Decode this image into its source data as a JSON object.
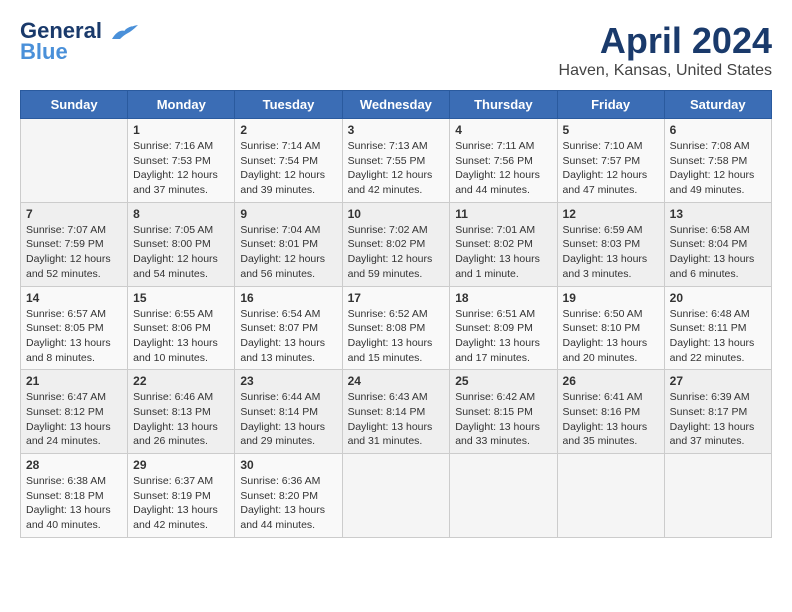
{
  "app": {
    "logo_line1": "General",
    "logo_line2": "Blue",
    "title": "April 2024",
    "subtitle": "Haven, Kansas, United States"
  },
  "calendar": {
    "headers": [
      "Sunday",
      "Monday",
      "Tuesday",
      "Wednesday",
      "Thursday",
      "Friday",
      "Saturday"
    ],
    "rows": [
      [
        {
          "day": "",
          "info": ""
        },
        {
          "day": "1",
          "info": "Sunrise: 7:16 AM\nSunset: 7:53 PM\nDaylight: 12 hours\nand 37 minutes."
        },
        {
          "day": "2",
          "info": "Sunrise: 7:14 AM\nSunset: 7:54 PM\nDaylight: 12 hours\nand 39 minutes."
        },
        {
          "day": "3",
          "info": "Sunrise: 7:13 AM\nSunset: 7:55 PM\nDaylight: 12 hours\nand 42 minutes."
        },
        {
          "day": "4",
          "info": "Sunrise: 7:11 AM\nSunset: 7:56 PM\nDaylight: 12 hours\nand 44 minutes."
        },
        {
          "day": "5",
          "info": "Sunrise: 7:10 AM\nSunset: 7:57 PM\nDaylight: 12 hours\nand 47 minutes."
        },
        {
          "day": "6",
          "info": "Sunrise: 7:08 AM\nSunset: 7:58 PM\nDaylight: 12 hours\nand 49 minutes."
        }
      ],
      [
        {
          "day": "7",
          "info": "Sunrise: 7:07 AM\nSunset: 7:59 PM\nDaylight: 12 hours\nand 52 minutes."
        },
        {
          "day": "8",
          "info": "Sunrise: 7:05 AM\nSunset: 8:00 PM\nDaylight: 12 hours\nand 54 minutes."
        },
        {
          "day": "9",
          "info": "Sunrise: 7:04 AM\nSunset: 8:01 PM\nDaylight: 12 hours\nand 56 minutes."
        },
        {
          "day": "10",
          "info": "Sunrise: 7:02 AM\nSunset: 8:02 PM\nDaylight: 12 hours\nand 59 minutes."
        },
        {
          "day": "11",
          "info": "Sunrise: 7:01 AM\nSunset: 8:02 PM\nDaylight: 13 hours\nand 1 minute."
        },
        {
          "day": "12",
          "info": "Sunrise: 6:59 AM\nSunset: 8:03 PM\nDaylight: 13 hours\nand 3 minutes."
        },
        {
          "day": "13",
          "info": "Sunrise: 6:58 AM\nSunset: 8:04 PM\nDaylight: 13 hours\nand 6 minutes."
        }
      ],
      [
        {
          "day": "14",
          "info": "Sunrise: 6:57 AM\nSunset: 8:05 PM\nDaylight: 13 hours\nand 8 minutes."
        },
        {
          "day": "15",
          "info": "Sunrise: 6:55 AM\nSunset: 8:06 PM\nDaylight: 13 hours\nand 10 minutes."
        },
        {
          "day": "16",
          "info": "Sunrise: 6:54 AM\nSunset: 8:07 PM\nDaylight: 13 hours\nand 13 minutes."
        },
        {
          "day": "17",
          "info": "Sunrise: 6:52 AM\nSunset: 8:08 PM\nDaylight: 13 hours\nand 15 minutes."
        },
        {
          "day": "18",
          "info": "Sunrise: 6:51 AM\nSunset: 8:09 PM\nDaylight: 13 hours\nand 17 minutes."
        },
        {
          "day": "19",
          "info": "Sunrise: 6:50 AM\nSunset: 8:10 PM\nDaylight: 13 hours\nand 20 minutes."
        },
        {
          "day": "20",
          "info": "Sunrise: 6:48 AM\nSunset: 8:11 PM\nDaylight: 13 hours\nand 22 minutes."
        }
      ],
      [
        {
          "day": "21",
          "info": "Sunrise: 6:47 AM\nSunset: 8:12 PM\nDaylight: 13 hours\nand 24 minutes."
        },
        {
          "day": "22",
          "info": "Sunrise: 6:46 AM\nSunset: 8:13 PM\nDaylight: 13 hours\nand 26 minutes."
        },
        {
          "day": "23",
          "info": "Sunrise: 6:44 AM\nSunset: 8:14 PM\nDaylight: 13 hours\nand 29 minutes."
        },
        {
          "day": "24",
          "info": "Sunrise: 6:43 AM\nSunset: 8:14 PM\nDaylight: 13 hours\nand 31 minutes."
        },
        {
          "day": "25",
          "info": "Sunrise: 6:42 AM\nSunset: 8:15 PM\nDaylight: 13 hours\nand 33 minutes."
        },
        {
          "day": "26",
          "info": "Sunrise: 6:41 AM\nSunset: 8:16 PM\nDaylight: 13 hours\nand 35 minutes."
        },
        {
          "day": "27",
          "info": "Sunrise: 6:39 AM\nSunset: 8:17 PM\nDaylight: 13 hours\nand 37 minutes."
        }
      ],
      [
        {
          "day": "28",
          "info": "Sunrise: 6:38 AM\nSunset: 8:18 PM\nDaylight: 13 hours\nand 40 minutes."
        },
        {
          "day": "29",
          "info": "Sunrise: 6:37 AM\nSunset: 8:19 PM\nDaylight: 13 hours\nand 42 minutes."
        },
        {
          "day": "30",
          "info": "Sunrise: 6:36 AM\nSunset: 8:20 PM\nDaylight: 13 hours\nand 44 minutes."
        },
        {
          "day": "",
          "info": ""
        },
        {
          "day": "",
          "info": ""
        },
        {
          "day": "",
          "info": ""
        },
        {
          "day": "",
          "info": ""
        }
      ]
    ]
  }
}
